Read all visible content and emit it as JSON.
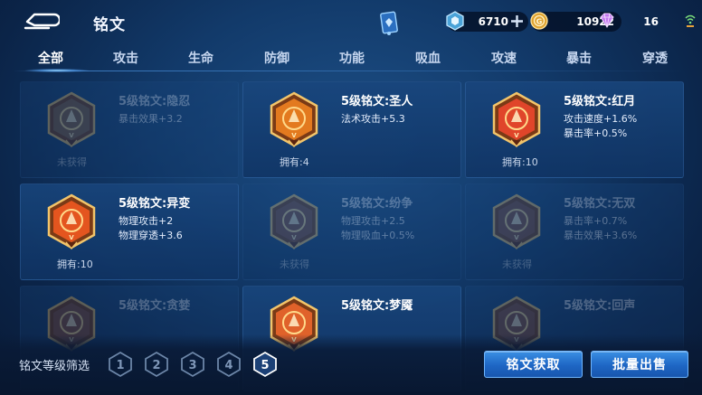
{
  "header": {
    "title": "铭文",
    "currencies": [
      {
        "name": "ticket",
        "value": "6710",
        "icon": "hex-coin-icon"
      },
      {
        "name": "gold",
        "value": "10922",
        "icon": "gold-coin-icon"
      },
      {
        "name": "gem",
        "value": "16",
        "icon": "diamond-icon"
      }
    ]
  },
  "tabs": [
    {
      "label": "全部",
      "active": true
    },
    {
      "label": "攻击"
    },
    {
      "label": "生命"
    },
    {
      "label": "防御"
    },
    {
      "label": "功能"
    },
    {
      "label": "吸血"
    },
    {
      "label": "攻速"
    },
    {
      "label": "暴击"
    },
    {
      "label": "穿透"
    }
  ],
  "cards": [
    {
      "title": "5级铭文:隐忍",
      "stats": [
        "暴击效果+3.2"
      ],
      "owned": "未获得",
      "obtained": false,
      "color": "#8a5f3c"
    },
    {
      "title": "5级铭文:圣人",
      "stats": [
        "法术攻击+5.3"
      ],
      "owned": "拥有:4",
      "obtained": true,
      "color": "#e37a1f"
    },
    {
      "title": "5级铭文:红月",
      "stats": [
        "攻击速度+1.6%",
        "暴击率+0.5%"
      ],
      "owned": "拥有:10",
      "obtained": true,
      "color": "#e0452a"
    },
    {
      "title": "5级铭文:异变",
      "stats": [
        "物理攻击+2",
        "物理穿透+3.6"
      ],
      "owned": "拥有:10",
      "obtained": true,
      "color": "#e4551f"
    },
    {
      "title": "5级铭文:纷争",
      "stats": [
        "物理攻击+2.5",
        "物理吸血+0.5%"
      ],
      "owned": "未获得",
      "obtained": false,
      "color": "#8a4d37"
    },
    {
      "title": "5级铭文:无双",
      "stats": [
        "暴击率+0.7%",
        "暴击效果+3.6%"
      ],
      "owned": "未获得",
      "obtained": false,
      "color": "#8a4d37"
    },
    {
      "title": "5级铭文:贪婪",
      "stats": [],
      "owned": "",
      "obtained": false,
      "color": "#8a4d37"
    },
    {
      "title": "5级铭文:梦魇",
      "stats": [],
      "owned": "",
      "obtained": true,
      "color": "#e0622a"
    },
    {
      "title": "5级铭文:回声",
      "stats": [],
      "owned": "",
      "obtained": false,
      "color": "#8a4d37"
    }
  ],
  "footer": {
    "filter_label": "铭文等级筛选",
    "levels": [
      "1",
      "2",
      "3",
      "4",
      "5"
    ],
    "active_level": "5",
    "get_button": "铭文获取",
    "sell_button": "批量出售"
  }
}
